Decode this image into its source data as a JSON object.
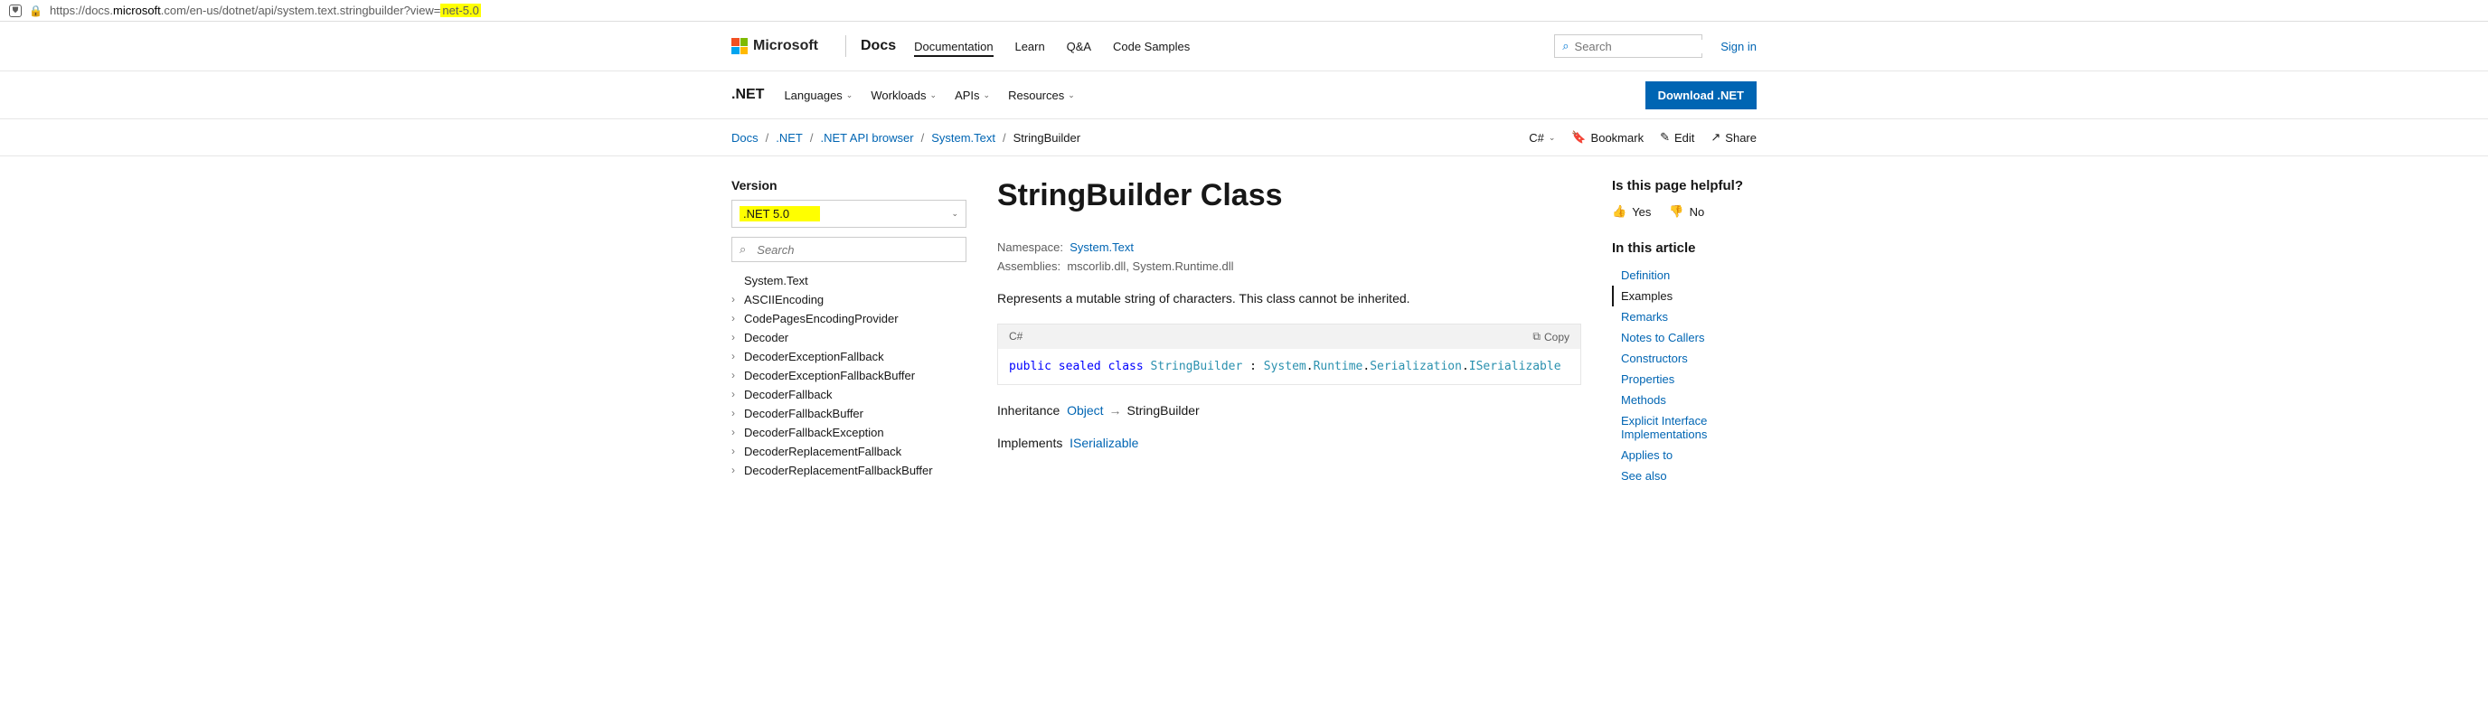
{
  "url": {
    "prefix": "https://docs.",
    "domain": "microsoft",
    "path": ".com/en-us/dotnet/api/system.text.stringbuilder?view=",
    "highlighted": "net-5.0"
  },
  "header": {
    "microsoft": "Microsoft",
    "docs": "Docs",
    "nav": {
      "documentation": "Documentation",
      "learn": "Learn",
      "qa": "Q&A",
      "samples": "Code Samples"
    },
    "search_placeholder": "Search",
    "signin": "Sign in"
  },
  "secnav": {
    "brand": ".NET",
    "languages": "Languages",
    "workloads": "Workloads",
    "apis": "APIs",
    "resources": "Resources",
    "download": "Download .NET"
  },
  "breadcrumb": {
    "docs": "Docs",
    "net": ".NET",
    "api": ".NET API browser",
    "ns": "System.Text",
    "current": "StringBuilder"
  },
  "actions": {
    "lang": "C#",
    "bookmark": "Bookmark",
    "edit": "Edit",
    "share": "Share"
  },
  "left": {
    "version_label": "Version",
    "version_selected": ".NET 5.0",
    "search_placeholder": "Search",
    "items": [
      "System.Text",
      "ASCIIEncoding",
      "CodePagesEncodingProvider",
      "Decoder",
      "DecoderExceptionFallback",
      "DecoderExceptionFallbackBuffer",
      "DecoderFallback",
      "DecoderFallbackBuffer",
      "DecoderFallbackException",
      "DecoderReplacementFallback",
      "DecoderReplacementFallbackBuffer"
    ]
  },
  "content": {
    "title": "StringBuilder Class",
    "ns_label": "Namespace:",
    "ns_value": "System.Text",
    "asm_label": "Assemblies:",
    "asm_value": "mscorlib.dll, System.Runtime.dll",
    "summary": "Represents a mutable string of characters. This class cannot be inherited.",
    "code_lang": "C#",
    "copy": "Copy",
    "code": {
      "k1": "public sealed class",
      "t1": "StringBuilder",
      "p1": ":",
      "t2": "System",
      "p2": ".",
      "t3": "Runtime",
      "p3": ".",
      "t4": "Serialization",
      "p4": ".",
      "t5": "ISerializable"
    },
    "inheritance_label": "Inheritance",
    "inheritance_root": "Object",
    "inheritance_leaf": "StringBuilder",
    "implements_label": "Implements",
    "implements_value": "ISerializable"
  },
  "right": {
    "helpful": "Is this page helpful?",
    "yes": "Yes",
    "no": "No",
    "in_article": "In this article",
    "nav": [
      "Definition",
      "Examples",
      "Remarks",
      "Notes to Callers",
      "Constructors",
      "Properties",
      "Methods",
      "Explicit Interface Implementations",
      "Applies to",
      "See also"
    ]
  }
}
